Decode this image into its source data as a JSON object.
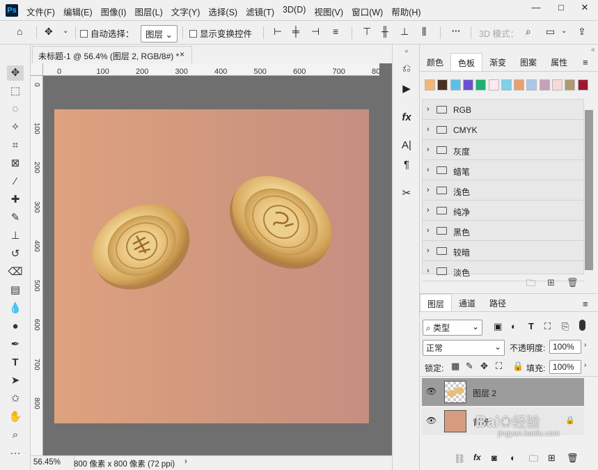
{
  "app": {
    "logo_text": "Ps"
  },
  "menu": [
    "文件(F)",
    "编辑(E)",
    "图像(I)",
    "图层(L)",
    "文字(Y)",
    "选择(S)",
    "滤镜(T)",
    "3D(D)",
    "视图(V)",
    "窗口(W)",
    "帮助(H)"
  ],
  "window_controls": {
    "minimize": "—",
    "maximize": "□",
    "close": "✕"
  },
  "options": {
    "auto_select_label": "自动选择：",
    "auto_select_target": "图层",
    "show_transform_label": "显示变换控件",
    "mode_3d_label": "3D 模式：",
    "more": "···"
  },
  "doc_tab": {
    "title": "未标题-1 @ 56.4% (图层 2, RGB/8#) *",
    "close": "×"
  },
  "ruler_h": [
    "0",
    "100",
    "200",
    "300",
    "400",
    "500",
    "600",
    "700",
    "80"
  ],
  "ruler_v": [
    "0",
    "100",
    "200",
    "300",
    "400",
    "500",
    "600",
    "700",
    "800"
  ],
  "status": {
    "zoom": "56.45%",
    "doc_info": "800 像素 x 800 像素 (72 ppi)",
    "arrow": "›"
  },
  "swatch_panel": {
    "tabs": [
      "颜色",
      "色板",
      "渐变",
      "图案",
      "属性"
    ],
    "active_tab": "色板",
    "recent_colors": [
      "#f5b66e",
      "#4a3020",
      "#5bc0e8",
      "#6a4fcf",
      "#20b070",
      "#ffe8f0",
      "#7fd0ea",
      "#e8a070",
      "#a8c8e8",
      "#c8a0b8",
      "#f8d8d8",
      "#b09870",
      "#a01830"
    ],
    "groups": [
      "RGB",
      "CMYK",
      "灰度",
      "蜡笔",
      "浅色",
      "纯净",
      "黑色",
      "较暗",
      "淡色"
    ]
  },
  "layers_panel": {
    "tabs": [
      "图层",
      "通道",
      "路径"
    ],
    "active_tab": "图层",
    "filter_label": "类型",
    "blend_mode": "正常",
    "opacity_label": "不透明度:",
    "opacity": "100%",
    "lock_label": "锁定:",
    "fill_label": "填充:",
    "fill": "100%",
    "layers": [
      {
        "name": "图层 2",
        "selected": true,
        "visible": true,
        "locked": false
      },
      {
        "name": "背景",
        "selected": false,
        "visible": true,
        "locked": true
      }
    ]
  },
  "watermark": {
    "brand": "Bai",
    "site": "jingyan.baidu.com",
    "text": "经验"
  },
  "colors": {
    "canvas_left": "#dfa27f",
    "canvas_right": "#c68e80",
    "workspace": "#6f6f6f",
    "panel_bg": "#f0f0f0"
  }
}
